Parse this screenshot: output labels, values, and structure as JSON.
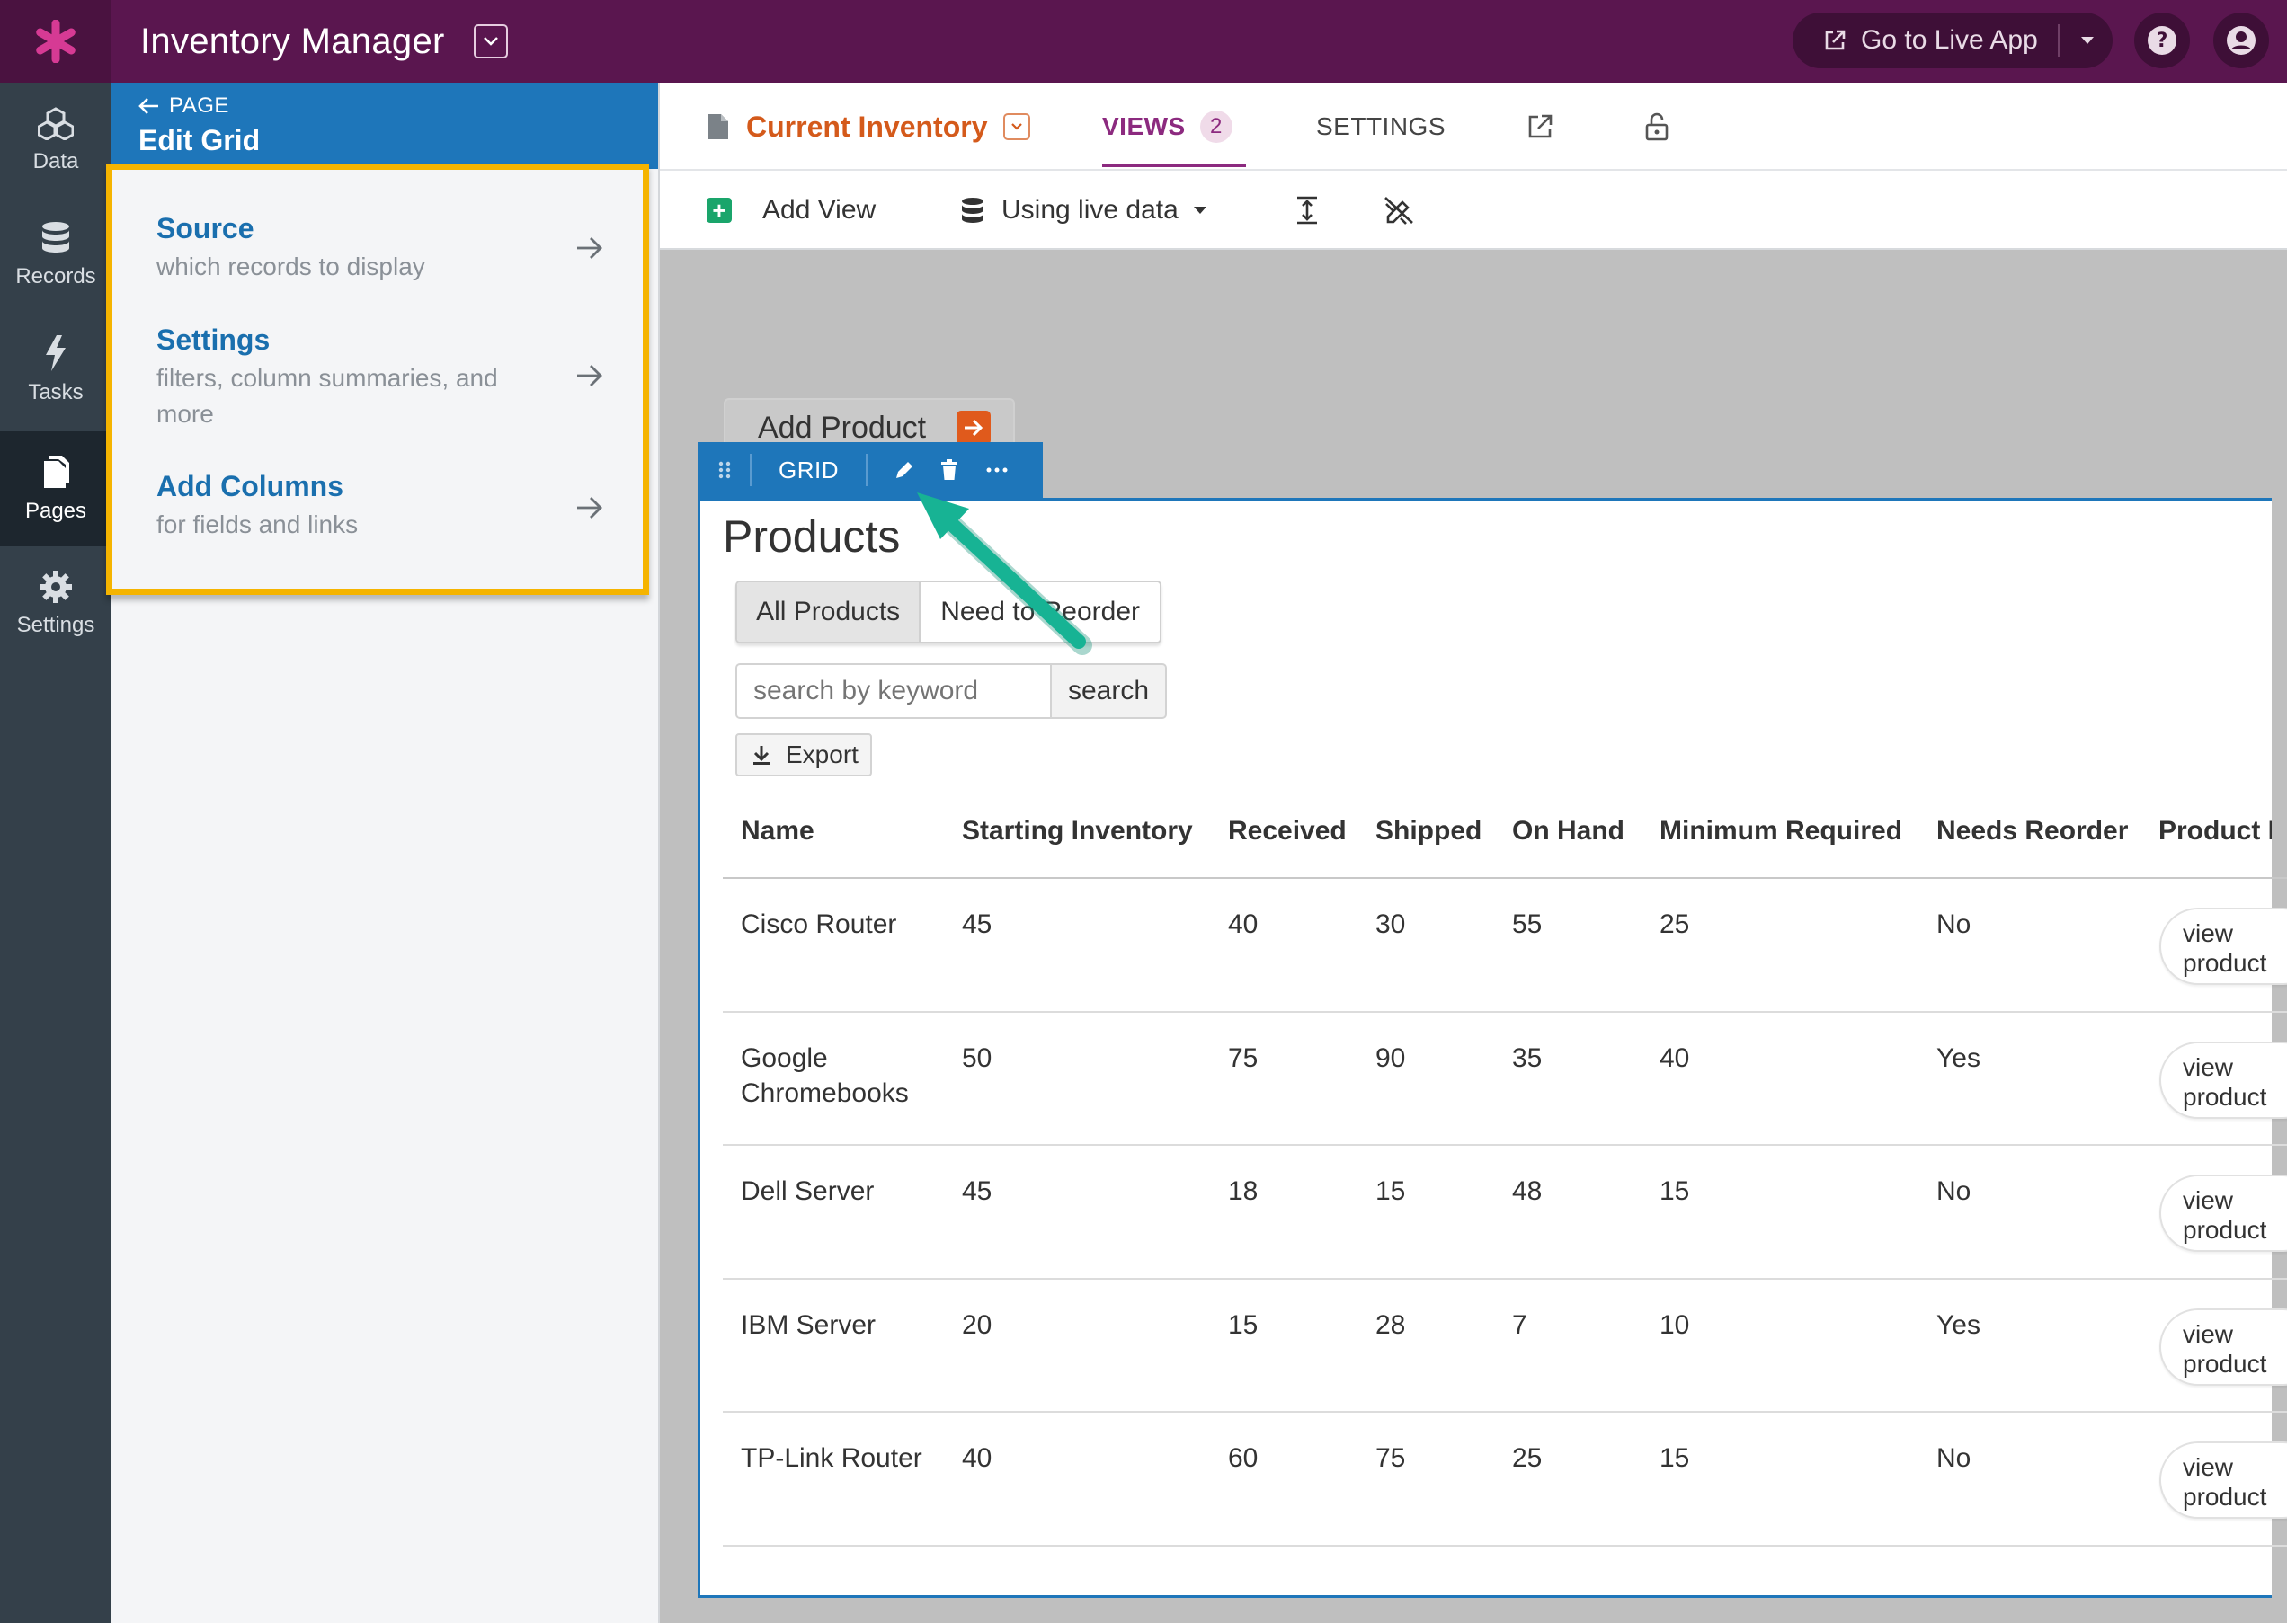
{
  "topbar": {
    "app_title": "Inventory Manager",
    "live_app_label": "Go to Live App"
  },
  "leftnav": {
    "items": [
      {
        "label": "Data",
        "icon": "cubes-icon"
      },
      {
        "label": "Records",
        "icon": "database-icon"
      },
      {
        "label": "Tasks",
        "icon": "bolt-icon"
      },
      {
        "label": "Pages",
        "icon": "pages-icon",
        "active": true
      },
      {
        "label": "Settings",
        "icon": "gear-icon"
      }
    ]
  },
  "panel": {
    "back_label": "PAGE",
    "title": "Edit Grid",
    "links": [
      {
        "title": "Source",
        "subtitle": "which records to display"
      },
      {
        "title": "Settings",
        "subtitle": "filters, column summaries, and more"
      },
      {
        "title": "Add Columns",
        "subtitle": "for fields and links"
      }
    ]
  },
  "pagehead": {
    "page_name": "Current Inventory",
    "views_label": "VIEWS",
    "views_count": "2",
    "settings_label": "SETTINGS"
  },
  "toolbar": {
    "add_view_label": "Add View",
    "data_mode_label": "Using live data"
  },
  "canvas": {
    "add_product_label": "Add Product",
    "grid_label": "GRID",
    "view_title": "Products",
    "filters": [
      "All Products",
      "Need to Reorder"
    ],
    "search_placeholder": "search by keyword",
    "search_button": "search",
    "export_label": "Export"
  },
  "table": {
    "columns": [
      "Name",
      "Starting Inventory",
      "Received",
      "Shipped",
      "On Hand",
      "Minimum Required",
      "Needs Reorder",
      "Product D"
    ],
    "link_label": "view product",
    "rows": [
      [
        "Cisco Router",
        "45",
        "40",
        "30",
        "55",
        "25",
        "No"
      ],
      [
        "Google Chromebooks",
        "50",
        "75",
        "90",
        "35",
        "40",
        "Yes"
      ],
      [
        "Dell Server",
        "45",
        "18",
        "15",
        "48",
        "15",
        "No"
      ],
      [
        "IBM Server",
        "20",
        "15",
        "28",
        "7",
        "10",
        "Yes"
      ],
      [
        "TP-Link Router",
        "40",
        "60",
        "75",
        "25",
        "15",
        "No"
      ]
    ]
  },
  "colors": {
    "topbar": "#5a164f",
    "nav": "#34404a",
    "panel_header": "#1e76ba",
    "highlight": "#f5b400",
    "accent_orange": "#d45a1b",
    "views_purple": "#8c2a7f",
    "annotation_arrow": "#17b394"
  }
}
